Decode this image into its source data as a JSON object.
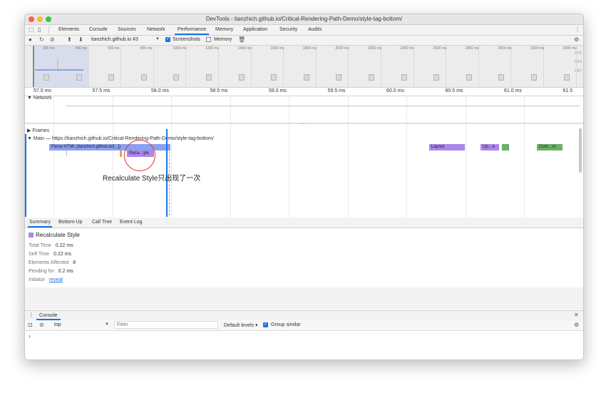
{
  "window": {
    "title": "DevTools - tianzhich.github.io/Critical-Rendering-Path-Demo/style-tag-bottom/"
  },
  "tabs": [
    {
      "label": "Elements"
    },
    {
      "label": "Console"
    },
    {
      "label": "Sources"
    },
    {
      "label": "Network"
    },
    {
      "label": "Performance",
      "active": true
    },
    {
      "label": "Memory"
    },
    {
      "label": "Application"
    },
    {
      "label": "Security"
    },
    {
      "label": "Audits"
    }
  ],
  "toolbar": {
    "recording_select": "tianzhich.github.io #3",
    "screenshots_label": "Screenshots",
    "memory_label": "Memory"
  },
  "overview": {
    "ticks": [
      "200 ms",
      "400 ms",
      "600 ms",
      "800 ms",
      "1000 ms",
      "1200 ms",
      "1400 ms",
      "1600 ms",
      "1800 ms",
      "2000 ms",
      "2200 ms",
      "2400 ms",
      "2600 ms",
      "2800 ms",
      "3000 ms",
      "3200 ms",
      "3400 ms"
    ],
    "labels": {
      "fps": "FPS",
      "cpu": "CPU",
      "net": "NET"
    }
  },
  "ruler": {
    "ticks": [
      "57.0 ms",
      "57.5 ms",
      "58.0 ms",
      "58.5 ms",
      "59.0 ms",
      "59.5 ms",
      "60.0 ms",
      "60.5 ms",
      "61.0 ms",
      "61.5"
    ]
  },
  "tracks": {
    "network": "Network",
    "frames": "Frames",
    "main": "Main — https://tianzhich.github.io/Critical-Rendering-Path-Demo/style-tag-bottom/"
  },
  "events": {
    "parse_html": "Parse HTML (tianzhich.github.io/[...])",
    "recalc_style": "Reca…yle",
    "layout": "Layout",
    "update": "Up…e",
    "composite": "Com…rs"
  },
  "annotation": "Recalculate Style只出现了一次",
  "bottom_tabs": [
    {
      "label": "Summary",
      "active": true
    },
    {
      "label": "Bottom-Up"
    },
    {
      "label": "Call Tree"
    },
    {
      "label": "Event Log"
    }
  ],
  "summary": {
    "title": "Recalculate Style",
    "rows": [
      {
        "key": "Total Time",
        "value": "0.22 ms"
      },
      {
        "key": "Self Time",
        "value": "0.22 ms"
      },
      {
        "key": "Elements Affected",
        "value": "8"
      },
      {
        "key": "Pending for",
        "value": "0.2 ms"
      },
      {
        "key": "Initiator",
        "value": "reveal"
      }
    ]
  },
  "console": {
    "tab": "Console",
    "context": "top",
    "filter_placeholder": "Filter",
    "levels": "Default levels ▾",
    "group_similar": "Group similar",
    "prompt": "›"
  },
  "colors": {
    "accent": "#1a73e8",
    "loading": "#8c9ff0",
    "rendering": "#a986ea",
    "painting": "#6bb065",
    "scripting": "#f2c64c"
  }
}
